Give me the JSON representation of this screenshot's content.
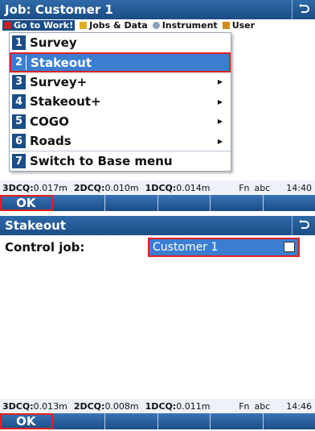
{
  "screen1": {
    "title": "Job: Customer 1",
    "menubar": [
      {
        "label": "Go to Work!",
        "icon": "go-to-work-icon",
        "color": "#cc1f1f",
        "active": true
      },
      {
        "label": "Jobs & Data",
        "icon": "folder-icon",
        "color": "#e0b020"
      },
      {
        "label": "Instrument",
        "icon": "instrument-icon",
        "color": "#8aa0b8"
      },
      {
        "label": "User",
        "icon": "user-icon",
        "color": "#d08a20"
      }
    ],
    "menu": [
      {
        "num": "1",
        "label": "Survey"
      },
      {
        "num": "2",
        "label": "Stakeout"
      },
      {
        "num": "3",
        "label": "Survey+"
      },
      {
        "num": "4",
        "label": "Stakeout+"
      },
      {
        "num": "5",
        "label": "COGO"
      },
      {
        "num": "6",
        "label": "Roads"
      },
      {
        "num": "7",
        "label": "Switch to Base menu"
      }
    ],
    "status": {
      "q3_label": "3DCQ:",
      "q3_value": "0.017m",
      "q2_label": "2DCQ:",
      "q2_value": "0.010m",
      "q1_label": "1DCQ:",
      "q1_value": "0.014m",
      "fn": "Fn",
      "input_mode": "abc",
      "time": "14:40"
    },
    "softkeys": [
      "OK",
      "",
      "",
      "",
      "",
      ""
    ]
  },
  "screen2": {
    "title": "Stakeout",
    "control_job_label": "Control job:",
    "control_job_value": "Customer 1",
    "status": {
      "q3_label": "3DCQ:",
      "q3_value": "0.013m",
      "q2_label": "2DCQ:",
      "q2_value": "0.008m",
      "q1_label": "1DCQ:",
      "q1_value": "0.011m",
      "fn": "Fn",
      "input_mode": "abc",
      "time": "14:46"
    },
    "softkeys": [
      "OK",
      "",
      "",
      "",
      "",
      ""
    ]
  },
  "colors": {
    "title_bg": "#1b4d86",
    "selection": "#3b7ed1",
    "highlight_outline": "#e02020"
  }
}
